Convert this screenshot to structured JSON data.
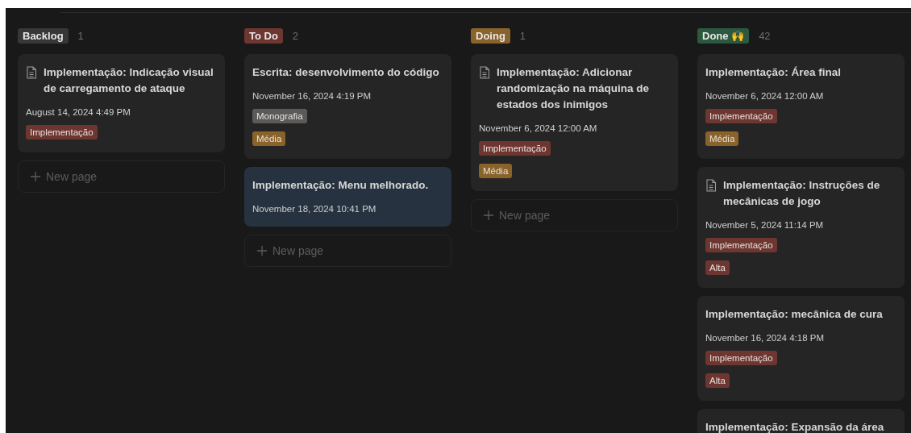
{
  "columns": [
    {
      "label": "Backlog",
      "color": "#373737",
      "count": "1",
      "cards": [
        {
          "icon": true,
          "selected": false,
          "title": "Implementação: Indicação visual de carregamento de ataque",
          "date": "August 14, 2024 4:49 PM",
          "tags": [
            {
              "text": "Implementação",
              "color": "#6e3630"
            }
          ]
        }
      ],
      "new_page": "New page"
    },
    {
      "label": "To Do",
      "color": "#6e3630",
      "count": "2",
      "cards": [
        {
          "icon": false,
          "selected": false,
          "title": "Escrita: desenvolvimento do código",
          "date": "November 16, 2024 4:19 PM",
          "tags": [
            {
              "text": "Monografia",
              "color": "#5a5a5a"
            },
            {
              "text": "Média",
              "color": "#89632a"
            }
          ]
        },
        {
          "icon": false,
          "selected": true,
          "title": "Implementação: Menu melhorado.",
          "date": "November 18, 2024 10:41 PM"
        }
      ],
      "new_page": "New page"
    },
    {
      "label": "Doing",
      "color": "#89632a",
      "count": "1",
      "cards": [
        {
          "icon": true,
          "selected": false,
          "title": "Implementação: Adicionar randomização na máquina de estados dos inimigos",
          "date": "November 6, 2024 12:00 AM",
          "tags": [
            {
              "text": "Implementação",
              "color": "#6e3630"
            },
            {
              "text": "Média",
              "color": "#89632a"
            }
          ]
        }
      ],
      "new_page": "New page"
    },
    {
      "label": "Done 🙌",
      "color": "#2b593f",
      "count": "42",
      "cards": [
        {
          "icon": false,
          "selected": false,
          "title": "Implementação: Área final",
          "date": "November 6, 2024 12:00 AM",
          "tags": [
            {
              "text": "Implementação",
              "color": "#6e3630"
            },
            {
              "text": "Média",
              "color": "#89632a"
            }
          ]
        },
        {
          "icon": true,
          "selected": false,
          "title": "Implementação: Instruções de mecânicas de jogo",
          "date": "November 5, 2024 11:14 PM",
          "tags": [
            {
              "text": "Implementação",
              "color": "#6e3630"
            },
            {
              "text": "Alta",
              "color": "#6e3630"
            }
          ]
        },
        {
          "icon": false,
          "selected": false,
          "title": "Implementação: mecânica de cura",
          "date": "November 16, 2024 4:18 PM",
          "tags": [
            {
              "text": "Implementação",
              "color": "#6e3630"
            },
            {
              "text": "Alta",
              "color": "#6e3630"
            }
          ]
        },
        {
          "icon": false,
          "selected": false,
          "title": "Implementação: Expansão da área"
        }
      ]
    }
  ]
}
